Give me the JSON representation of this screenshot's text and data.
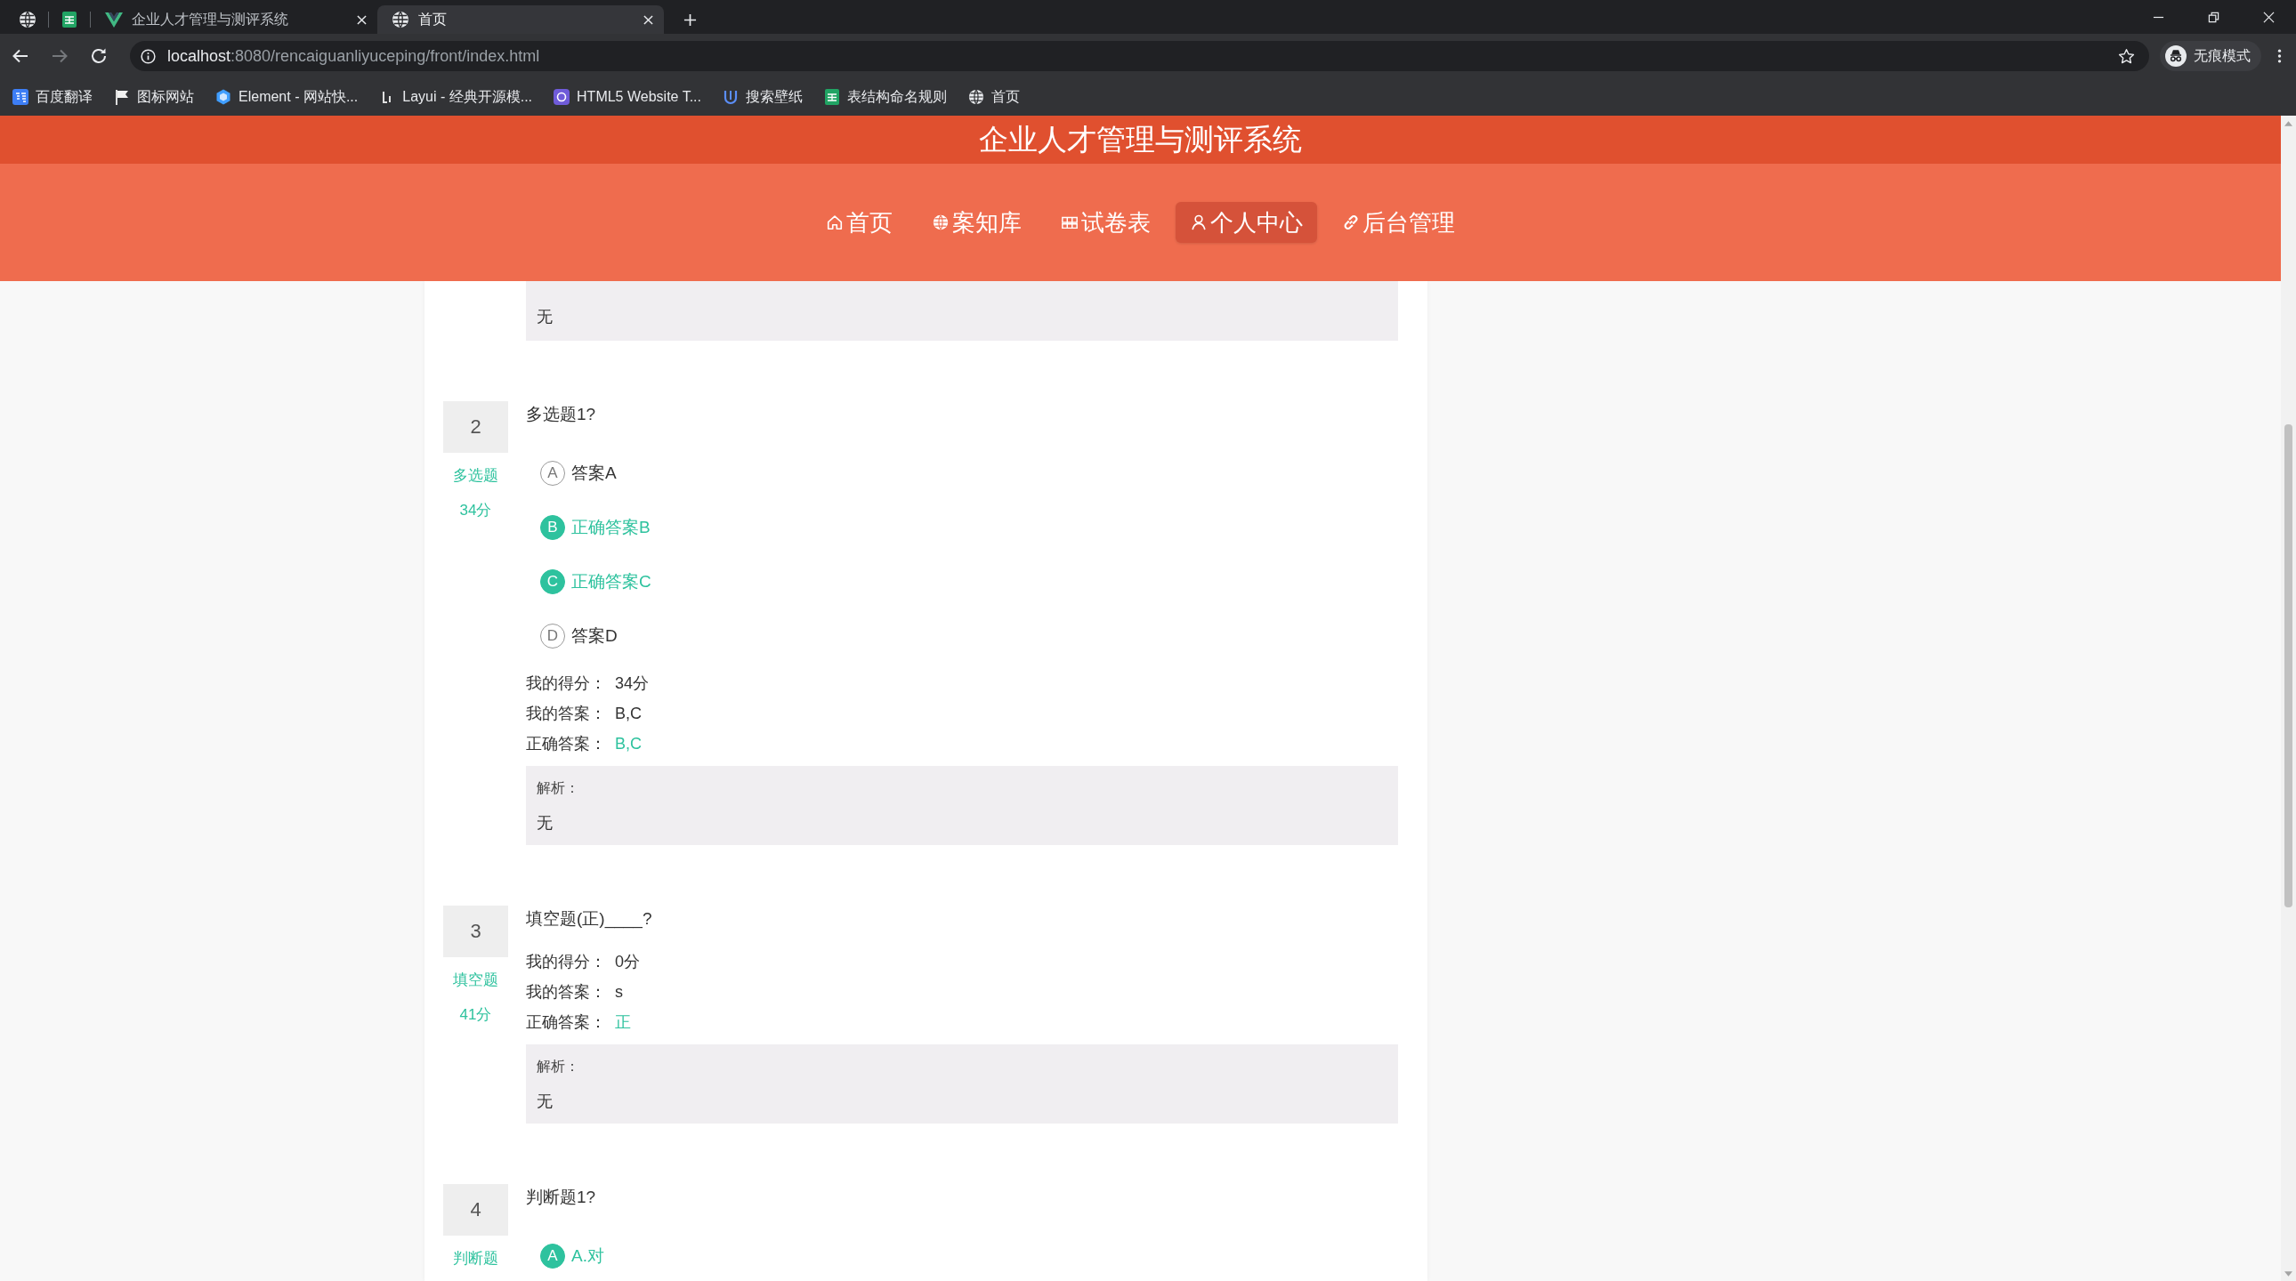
{
  "browser": {
    "tabs": [
      {
        "selected": false
      },
      {
        "selected": false
      },
      {
        "title": "企业人才管理与测评系统",
        "selected": false
      },
      {
        "title": "首页",
        "selected": true
      }
    ],
    "address": {
      "host": "localhost",
      "path": ":8080/rencaiguanliyuceping/front/index.html"
    },
    "profile": {
      "label": "无痕模式"
    },
    "bookmarks": [
      {
        "label": "百度翻译"
      },
      {
        "label": "图标网站"
      },
      {
        "label": "Element - 网站快..."
      },
      {
        "label": "Layui - 经典开源模..."
      },
      {
        "label": "HTML5 Website T..."
      },
      {
        "label": "搜索壁纸"
      },
      {
        "label": "表结构命名规则"
      },
      {
        "label": "首页"
      }
    ]
  },
  "header": {
    "title": "企业人才管理与测评系统",
    "nav": [
      {
        "label": "首页",
        "selected": false
      },
      {
        "label": "案知库",
        "selected": false
      },
      {
        "label": "试卷表",
        "selected": false
      },
      {
        "label": "个人中心",
        "selected": true
      },
      {
        "label": "后台管理",
        "selected": false
      }
    ]
  },
  "exam": {
    "previous_analysis": {
      "text": "无"
    },
    "questions": [
      {
        "number": "2",
        "type": "多选题",
        "points": "34分",
        "text": "多选题1?",
        "options": [
          {
            "letter": "A",
            "text": "答案A",
            "correct": false
          },
          {
            "letter": "B",
            "text": "正确答案B",
            "correct": true
          },
          {
            "letter": "C",
            "text": "正确答案C",
            "correct": true
          },
          {
            "letter": "D",
            "text": "答案D",
            "correct": false
          }
        ],
        "results": [
          {
            "kind": "score",
            "label": "我的得分：",
            "value": "34分"
          },
          {
            "kind": "answer",
            "label": "我的答案：",
            "value": "B,C"
          },
          {
            "kind": "correct_answer",
            "label": "正确答案：",
            "value": "B,C"
          }
        ],
        "analysis": {
          "label": "解析：",
          "text": "无"
        }
      },
      {
        "number": "3",
        "type": "填空题",
        "points": "41分",
        "text": "填空题(正)____?",
        "results": [
          {
            "kind": "score",
            "label": "我的得分：",
            "value": "0分"
          },
          {
            "kind": "answer",
            "label": "我的答案：",
            "value": "s"
          },
          {
            "kind": "correct_answer",
            "label": "正确答案：",
            "value": "正"
          }
        ],
        "analysis": {
          "label": "解析：",
          "text": "无"
        }
      },
      {
        "number": "4",
        "type": "判断题",
        "text": "判断题1?",
        "options": [
          {
            "letter": "A",
            "text": "A.对",
            "correct": true
          }
        ]
      }
    ]
  }
}
